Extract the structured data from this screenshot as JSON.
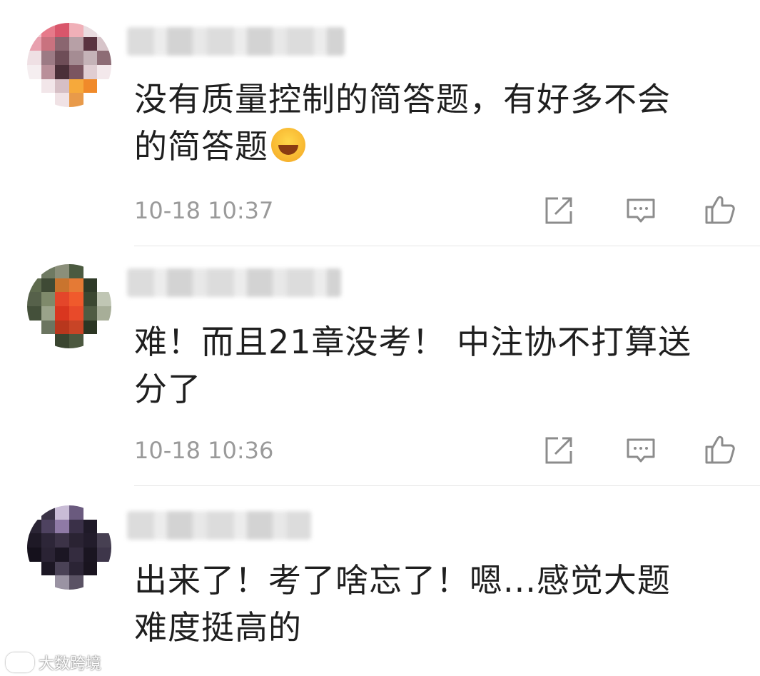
{
  "comments": [
    {
      "text_line1": "没有质量控制的简答题，有好多不会",
      "text_line2": "的简答题",
      "emoji": "laughing-crying",
      "time": "10-18 10:37",
      "avatar_colors": [
        "#f2c4cc",
        "#e67a8a",
        "#d9566b",
        "#f0b0b8",
        "#e9dce0",
        "#f7f0f2",
        "#e8a0ae",
        "#c9727f",
        "#8a6670",
        "#b7a0a6",
        "#5a3340",
        "#d7c4c9",
        "#efe0e4",
        "#9c7a84",
        "#6e4d57",
        "#a58c93",
        "#c5b3b8",
        "#8d6c75",
        "#f5eef0",
        "#b98f99",
        "#4a2f38",
        "#7b5560",
        "#e0cdd2",
        "#f3e8eb",
        "#ffffff",
        "#f2e6e9",
        "#d6bfc5",
        "#f6a93b",
        "#f08a2a",
        "#ffffff",
        "#ffffff",
        "#ffffff",
        "#f0e2e5",
        "#e89a4a",
        "#ffffff",
        "#ffffff"
      ]
    },
    {
      "text_line1": "难！而且21章没考！ 中注协不打算送",
      "text_line2": "分了",
      "time": "10-18 10:36",
      "avatar_colors": [
        "#ffffff",
        "#6f7a62",
        "#8b8f7a",
        "#4b5a40",
        "#ffffff",
        "#ffffff",
        "#5e6b4e",
        "#3f4a35",
        "#c9742e",
        "#e57a35",
        "#2f3a28",
        "#ffffff",
        "#56614a",
        "#7f8a6b",
        "#e4462a",
        "#f05a2c",
        "#3b4731",
        "#c0c6b4",
        "#44503a",
        "#9aa38a",
        "#d9361f",
        "#e84a2a",
        "#505c43",
        "#a7ae98",
        "#ffffff",
        "#6b7560",
        "#b8371d",
        "#c84426",
        "#2c3624",
        "#ffffff",
        "#ffffff",
        "#ffffff",
        "#3a4530",
        "#4c583f",
        "#ffffff",
        "#ffffff"
      ]
    },
    {
      "text_line1": "出来了！考了啥忘了！嗯...感觉大题",
      "text_line2": "难度挺高的",
      "avatar_colors": [
        "#ffffff",
        "#3b3346",
        "#c9bcd6",
        "#6a5a7e",
        "#ffffff",
        "#ffffff",
        "#2a2434",
        "#4e4260",
        "#8f7aa6",
        "#3a3048",
        "#1f1a28",
        "#ffffff",
        "#1e1926",
        "#2d2638",
        "#3c3347",
        "#2a2333",
        "#221c2b",
        "#474052",
        "#15111c",
        "#2a2334",
        "#1b1623",
        "#342c3f",
        "#1a1521",
        "#3e364a",
        "#ffffff",
        "#1c1724",
        "#4a4256",
        "#2b2435",
        "#19141f",
        "#ffffff",
        "#ffffff",
        "#ffffff",
        "#9a93a3",
        "#5a5264",
        "#ffffff",
        "#ffffff"
      ]
    }
  ],
  "icons": {
    "share": "share-icon",
    "reply": "comment-icon",
    "like": "thumbs-up-icon"
  },
  "watermark": {
    "text": "大数跨境"
  }
}
